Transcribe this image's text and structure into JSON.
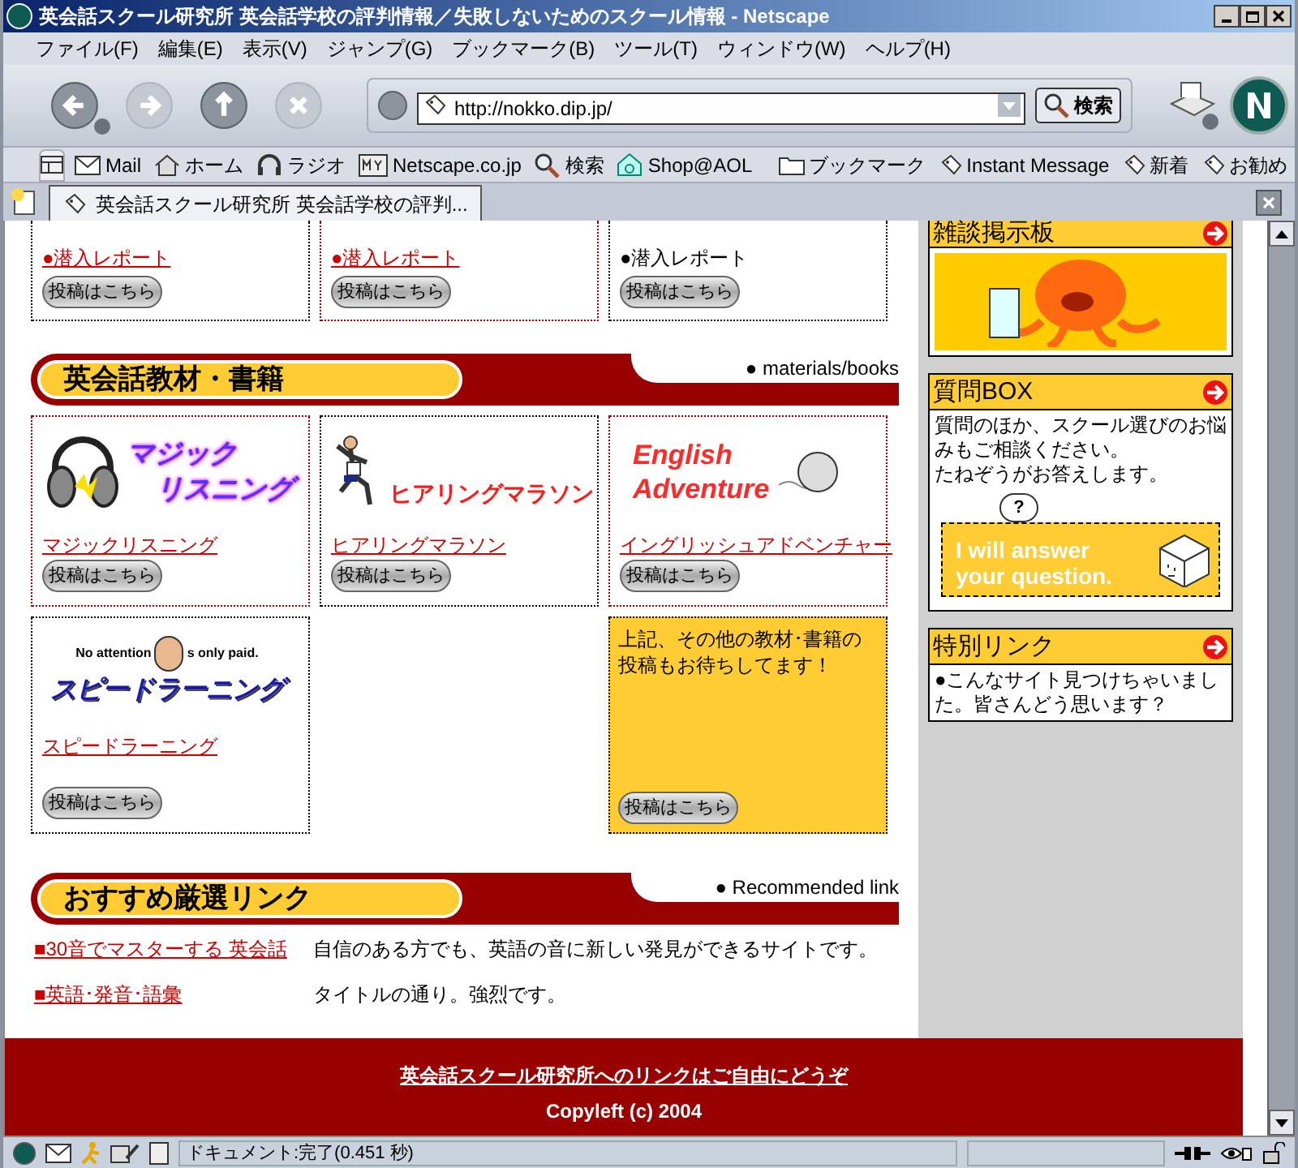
{
  "window": {
    "title": "英会話スクール研究所  英会話学校の評判情報／失敗しないためのスクール情報 - Netscape"
  },
  "menu": [
    "ファイル(F)",
    "編集(E)",
    "表示(V)",
    "ジャンプ(G)",
    "ブックマーク(B)",
    "ツール(T)",
    "ウィンドウ(W)",
    "ヘルプ(H)"
  ],
  "nav_buttons": [
    {
      "kind": "back",
      "disabled": false
    },
    {
      "kind": "forward",
      "disabled": true
    },
    {
      "kind": "reload",
      "disabled": false
    },
    {
      "kind": "stop",
      "disabled": true
    }
  ],
  "address": {
    "value": "http://nokko.dip.jp/"
  },
  "search_button": "検索",
  "personal_toolbar": [
    {
      "kind": "mail",
      "label": "Mail"
    },
    {
      "kind": "home",
      "label": "ホーム"
    },
    {
      "kind": "radio",
      "label": "ラジオ"
    },
    {
      "kind": "my",
      "label": "Netscape.co.jp"
    },
    {
      "kind": "search",
      "label": "検索"
    },
    {
      "kind": "shop",
      "label": "Shop@AOL"
    },
    {
      "kind": "folder",
      "label": "ブックマーク"
    },
    {
      "kind": "link",
      "label": "Instant Message"
    },
    {
      "kind": "link",
      "label": "新着"
    },
    {
      "kind": "link",
      "label": "お勧め"
    }
  ],
  "tab": {
    "label": "英会話スクール研究所  英会話学校の評判..."
  },
  "report_cards": [
    {
      "label": "●潜入レポート",
      "linked": true,
      "highlighted": false,
      "button": "投稿はこちら"
    },
    {
      "label": "●潜入レポート",
      "linked": true,
      "highlighted": true,
      "button": "投稿はこちら"
    },
    {
      "label": "●潜入レポート",
      "linked": false,
      "highlighted": false,
      "button": "投稿はこちら"
    }
  ],
  "books_section": {
    "title": "英会話教材・書籍",
    "subtitle": "● materials/books",
    "cards": [
      {
        "kind": "book",
        "logo": {
          "kind": "listening",
          "lines": [
            "マジック",
            "リスニング"
          ]
        },
        "link": "マジックリスニング",
        "button": "投稿はこちら",
        "highlighted": true
      },
      {
        "kind": "book",
        "logo": {
          "kind": "marathon",
          "lines": [
            "ヒアリングマラソン"
          ]
        },
        "link": "ヒアリングマラソン",
        "button": "投稿はこちら",
        "highlighted": false
      },
      {
        "kind": "book",
        "logo": {
          "kind": "adventure",
          "lines": [
            "English",
            "Adventure"
          ]
        },
        "link": "イングリッシュアドベンチャー",
        "button": "投稿はこちら",
        "highlighted": true
      },
      {
        "kind": "book",
        "logo": {
          "kind": "speed",
          "lines": [
            "スピードラーニング"
          ],
          "caption_left": "No attention",
          "caption_right": "s only paid."
        },
        "link": "スピードラーニング",
        "button": "投稿はこちら",
        "highlighted": false
      },
      {
        "kind": "empty"
      },
      {
        "kind": "note",
        "text": "上記、その他の教材･書籍の投稿もお待ちしてます！",
        "button": "投稿はこちら",
        "highlighted": false
      }
    ]
  },
  "links_section": {
    "title": "おすすめ厳選リンク",
    "subtitle": "● Recommended link",
    "links": [
      {
        "title": "■30音でマスターする 英会話",
        "description": "自信のある方でも、英語の音に新しい発見ができるサイトです。"
      },
      {
        "title": "■英語･発音･語彙",
        "description": "タイトルの通り。強烈です。"
      }
    ]
  },
  "sidebar": [
    {
      "kind": "picture",
      "title": "雑談掲示板"
    },
    {
      "kind": "question",
      "title": "質問BOX",
      "text": "質問のほか、スクール選びのお悩みもご相談ください。",
      "text2": "たねぞうがお答えします。",
      "banner": {
        "lines": [
          "I will answer",
          "your question."
        ],
        "bubble": "?"
      }
    },
    {
      "kind": "text",
      "title": "特別リンク",
      "text": "●こんなサイト見つけちゃいました。皆さんどう思います？"
    }
  ],
  "footer": {
    "link": "英会話スクール研究所へのリンクはご自由にどうぞ",
    "copyright": "Copyleft (c) 2004"
  },
  "status_bar": {
    "text": "ドキュメント:完了(0.451 秒)"
  }
}
